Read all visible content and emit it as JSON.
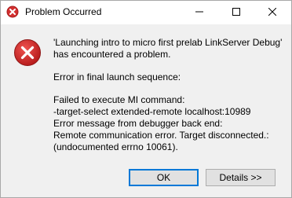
{
  "dialog": {
    "title": "Problem Occurred",
    "message_line_1": "'Launching intro to micro first prelab LinkServer Debug'",
    "message_line_2": "has encountered a problem.",
    "error_heading": "Error in final launch sequence:",
    "detail_lines": [
      "Failed to execute MI command:",
      "-target-select extended-remote localhost:10989",
      "Error message from debugger back end:",
      "Remote communication error.  Target disconnected.:",
      "(undocumented errno 10061)."
    ],
    "buttons": {
      "ok": "OK",
      "details": "Details >>"
    }
  },
  "icons": {
    "app": "app-icon",
    "error": "error-icon",
    "minimize": "minimize-icon",
    "maximize": "maximize-icon",
    "close": "close-icon"
  },
  "colors": {
    "error_red": "#c62828",
    "ok_focus_border": "#0078d7",
    "window_bg": "#f0f0f0"
  }
}
